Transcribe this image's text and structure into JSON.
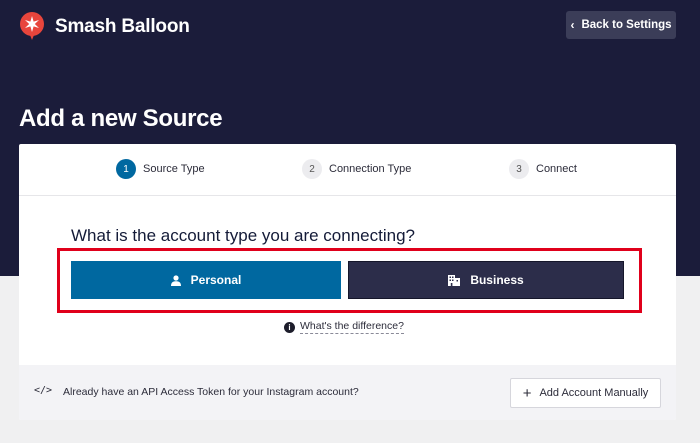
{
  "brand": {
    "name": "Smash Balloon",
    "logo_icon": "balloon-logo-icon"
  },
  "header": {
    "back_button": "Back to Settings"
  },
  "page": {
    "title": "Add a new Source"
  },
  "steps": [
    {
      "num": "1",
      "label": "Source Type",
      "active": true
    },
    {
      "num": "2",
      "label": "Connection Type",
      "active": false
    },
    {
      "num": "3",
      "label": "Connect",
      "active": false
    }
  ],
  "question": "What is the account type you are connecting?",
  "account_types": {
    "personal": {
      "label": "Personal",
      "icon": "user-icon"
    },
    "business": {
      "label": "Business",
      "icon": "building-icon"
    }
  },
  "difference_link": "What's the difference?",
  "footer": {
    "token_text": "Already have an API Access Token for your Instagram account?",
    "add_manual": "Add Account Manually"
  },
  "colors": {
    "hero_bg": "#1b1c3a",
    "primary": "#0068a0",
    "business_bg": "#2c2d4a",
    "highlight": "#e0001b",
    "brand_red": "#e8453c"
  }
}
